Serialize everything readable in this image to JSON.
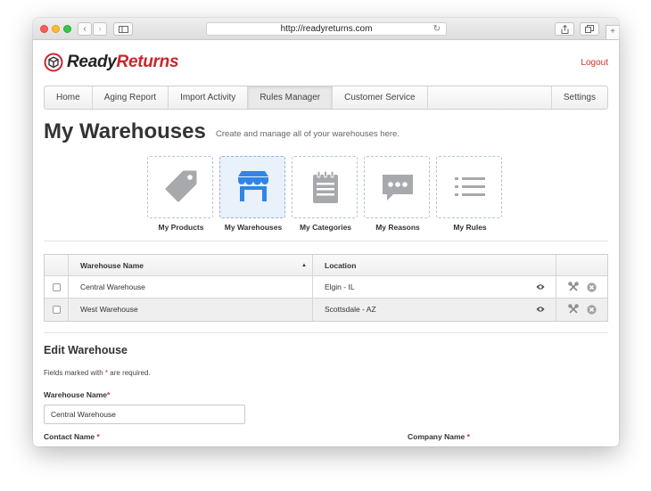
{
  "browser": {
    "url": "http://readyreturns.com"
  },
  "logo": {
    "part1": "Ready",
    "part2": "Returns"
  },
  "header": {
    "logout_label": "Logout"
  },
  "nav": {
    "items": [
      {
        "label": "Home"
      },
      {
        "label": "Aging Report"
      },
      {
        "label": "Import Activity"
      },
      {
        "label": "Rules Manager",
        "active": true
      },
      {
        "label": "Customer Service"
      }
    ],
    "settings_label": "Settings"
  },
  "page": {
    "title": "My Warehouses",
    "subtitle": "Create and manage all of your warehouses here."
  },
  "tiles": [
    {
      "label": "My Products",
      "icon": "tag-icon"
    },
    {
      "label": "My Warehouses",
      "icon": "storefront-icon",
      "active": true
    },
    {
      "label": "My Categories",
      "icon": "notepad-icon"
    },
    {
      "label": "My Reasons",
      "icon": "speech-bubble-icon"
    },
    {
      "label": "My Rules",
      "icon": "list-icon"
    }
  ],
  "table": {
    "columns": {
      "name": "Warehouse Name",
      "location": "Location"
    },
    "rows": [
      {
        "name": "Central Warehouse",
        "location": "Elgin - IL"
      },
      {
        "name": "West Warehouse",
        "location": "Scottsdale - AZ"
      }
    ]
  },
  "form": {
    "title": "Edit Warehouse",
    "required_note_pre": "Fields marked with",
    "required_star": "*",
    "required_note_post": "are required.",
    "warehouse_name_label": "Warehouse Name",
    "warehouse_name_value": "Central Warehouse",
    "contact_name_label": "Contact Name",
    "company_name_label": "Company Name"
  },
  "colors": {
    "brand_red": "#c9252c",
    "active_blue": "#2f86e8",
    "icon_gray": "#a7a9ac"
  }
}
